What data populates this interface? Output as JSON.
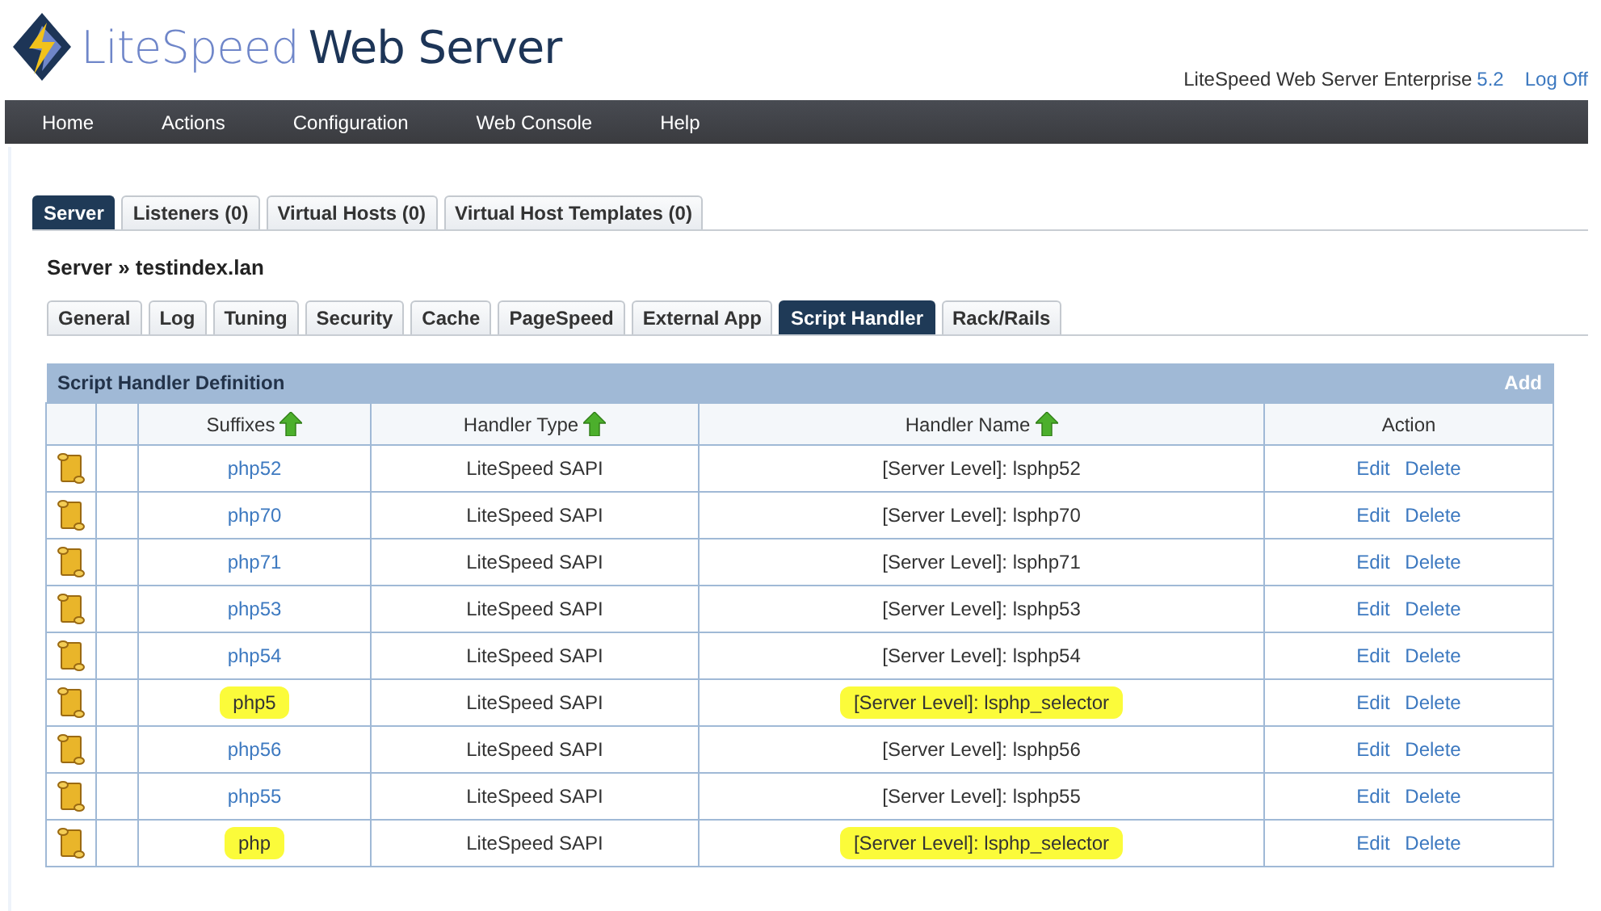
{
  "logo": {
    "part_1": "LiteSpeed",
    "part_2": "Web Server"
  },
  "version_info": {
    "label": "LiteSpeed Web Server Enterprise",
    "version": "5.2",
    "logoff": "Log Off"
  },
  "nav": [
    "Home",
    "Actions",
    "Configuration",
    "Web Console",
    "Help"
  ],
  "tabs": [
    {
      "label": "Server",
      "selected": true
    },
    {
      "label": "Listeners (0)",
      "selected": false
    },
    {
      "label": "Virtual Hosts (0)",
      "selected": false
    },
    {
      "label": "Virtual Host Templates (0)",
      "selected": false
    }
  ],
  "breadcrumb": "Server » testindex.lan",
  "subtabs": [
    {
      "label": "General",
      "selected": false
    },
    {
      "label": "Log",
      "selected": false
    },
    {
      "label": "Tuning",
      "selected": false
    },
    {
      "label": "Security",
      "selected": false
    },
    {
      "label": "Cache",
      "selected": false
    },
    {
      "label": "PageSpeed",
      "selected": false
    },
    {
      "label": "External App",
      "selected": false
    },
    {
      "label": "Script Handler",
      "selected": true
    },
    {
      "label": "Rack/Rails",
      "selected": false
    }
  ],
  "table": {
    "title": "Script Handler Definition",
    "add": "Add",
    "columns": [
      {
        "label": "Suffixes",
        "sortable": true
      },
      {
        "label": "Handler Type",
        "sortable": true
      },
      {
        "label": "Handler Name",
        "sortable": true
      },
      {
        "label": "Action",
        "sortable": false
      }
    ],
    "rows": [
      {
        "suffix": "php52",
        "type": "LiteSpeed SAPI",
        "name": "[Server Level]: lsphp52",
        "edit": "Edit",
        "delete": "Delete",
        "highlighted": false
      },
      {
        "suffix": "php70",
        "type": "LiteSpeed SAPI",
        "name": "[Server Level]: lsphp70",
        "edit": "Edit",
        "delete": "Delete",
        "highlighted": false
      },
      {
        "suffix": "php71",
        "type": "LiteSpeed SAPI",
        "name": "[Server Level]: lsphp71",
        "edit": "Edit",
        "delete": "Delete",
        "highlighted": false
      },
      {
        "suffix": "php53",
        "type": "LiteSpeed SAPI",
        "name": "[Server Level]: lsphp53",
        "edit": "Edit",
        "delete": "Delete",
        "highlighted": false
      },
      {
        "suffix": "php54",
        "type": "LiteSpeed SAPI",
        "name": "[Server Level]: lsphp54",
        "edit": "Edit",
        "delete": "Delete",
        "highlighted": false
      },
      {
        "suffix": "php5",
        "type": "LiteSpeed SAPI",
        "name": "[Server Level]: lsphp_selector",
        "edit": "Edit",
        "delete": "Delete",
        "highlighted": true
      },
      {
        "suffix": "php56",
        "type": "LiteSpeed SAPI",
        "name": "[Server Level]: lsphp56",
        "edit": "Edit",
        "delete": "Delete",
        "highlighted": false
      },
      {
        "suffix": "php55",
        "type": "LiteSpeed SAPI",
        "name": "[Server Level]: lsphp55",
        "edit": "Edit",
        "delete": "Delete",
        "highlighted": false
      },
      {
        "suffix": "php",
        "type": "LiteSpeed SAPI",
        "name": "[Server Level]: lsphp_selector",
        "edit": "Edit",
        "delete": "Delete",
        "highlighted": true
      }
    ]
  }
}
